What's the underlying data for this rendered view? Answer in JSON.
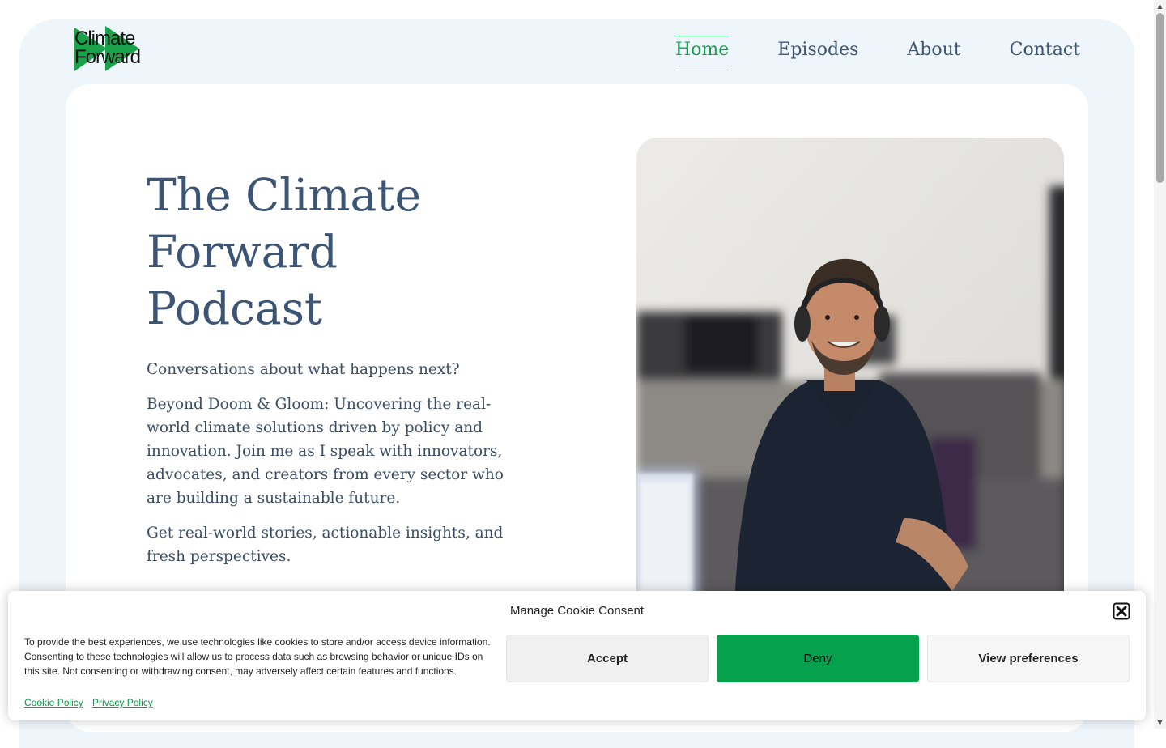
{
  "logo": {
    "line1": "Climate",
    "line2": "Forward",
    "accent": "#1aa34a"
  },
  "nav": {
    "items": [
      {
        "label": "Home",
        "active": true
      },
      {
        "label": "Episodes",
        "active": false
      },
      {
        "label": "About",
        "active": false
      },
      {
        "label": "Contact",
        "active": false
      }
    ],
    "active_color": "#14a04b",
    "text_color": "#3d5575"
  },
  "hero": {
    "title_line1": "The Climate",
    "title_line2": "Forward",
    "title_line3": "Podcast",
    "paragraphs": [
      "Conversations about what happens next?",
      "Beyond Doom & Gloom: Uncovering the real-world climate solutions driven by policy and innovation. Join me as I speak with innovators, advocates, and creators from every sector who are building a sustainable future.",
      "Get real-world stories, actionable insights, and fresh perspectives."
    ]
  },
  "cookie": {
    "title": "Manage Cookie Consent",
    "message": "To provide the best experiences, we use technologies like cookies to store and/or access device information. Consenting to these technologies will allow us to process data such as browsing behavior or unique IDs on this site. Not consenting or withdrawing consent, may adversely affect certain features and functions.",
    "accept_label": "Accept",
    "deny_label": "Deny",
    "preferences_label": "View preferences",
    "cookie_policy_label": "Cookie Policy",
    "privacy_policy_label": "Privacy Policy",
    "deny_color": "#05a14c"
  }
}
